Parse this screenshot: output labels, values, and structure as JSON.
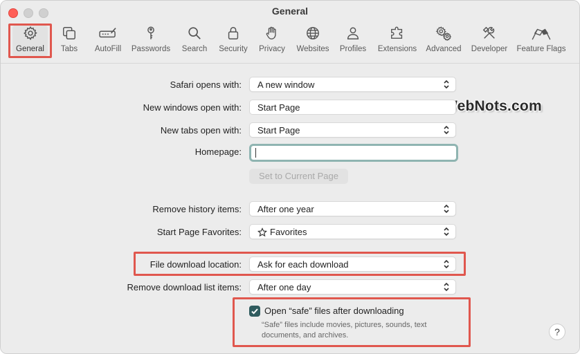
{
  "window": {
    "title": "General"
  },
  "toolbar": {
    "items": [
      {
        "label": "General",
        "icon": "gear-icon"
      },
      {
        "label": "Tabs",
        "icon": "tabs-icon"
      },
      {
        "label": "AutoFill",
        "icon": "autofill-icon"
      },
      {
        "label": "Passwords",
        "icon": "key-icon"
      },
      {
        "label": "Search",
        "icon": "search-icon"
      },
      {
        "label": "Security",
        "icon": "lock-icon"
      },
      {
        "label": "Privacy",
        "icon": "hand-icon"
      },
      {
        "label": "Websites",
        "icon": "globe-icon"
      },
      {
        "label": "Profiles",
        "icon": "person-icon"
      },
      {
        "label": "Extensions",
        "icon": "puzzle-icon"
      },
      {
        "label": "Advanced",
        "icon": "gears-icon"
      },
      {
        "label": "Developer",
        "icon": "tools-icon"
      },
      {
        "label": "Feature Flags",
        "icon": "flags-icon"
      }
    ]
  },
  "settings": {
    "safari_opens_with": {
      "label": "Safari opens with:",
      "value": "A new window"
    },
    "new_windows_open_with": {
      "label": "New windows open with:",
      "value": "Start Page"
    },
    "new_tabs_open_with": {
      "label": "New tabs open with:",
      "value": "Start Page"
    },
    "homepage": {
      "label": "Homepage:",
      "value": ""
    },
    "set_current_page": {
      "label": "Set to Current Page"
    },
    "remove_history_items": {
      "label": "Remove history items:",
      "value": "After one year"
    },
    "start_page_favorites": {
      "label": "Start Page Favorites:",
      "value": "Favorites"
    },
    "file_download_location": {
      "label": "File download location:",
      "value": "Ask for each download"
    },
    "remove_download_list_items": {
      "label": "Remove download list items:",
      "value": "After one day"
    },
    "open_safe_files": {
      "label": "Open “safe” files after downloading",
      "checked": true,
      "description": "“Safe” files include movies, pictures, sounds, text documents, and archives."
    }
  },
  "help": {
    "label": "?"
  },
  "watermark": {
    "text": "WebNots.com"
  },
  "colors": {
    "highlight": "#e0574e",
    "checkbox": "#2f5b5e",
    "focus_ring": "#8fb4b1"
  }
}
